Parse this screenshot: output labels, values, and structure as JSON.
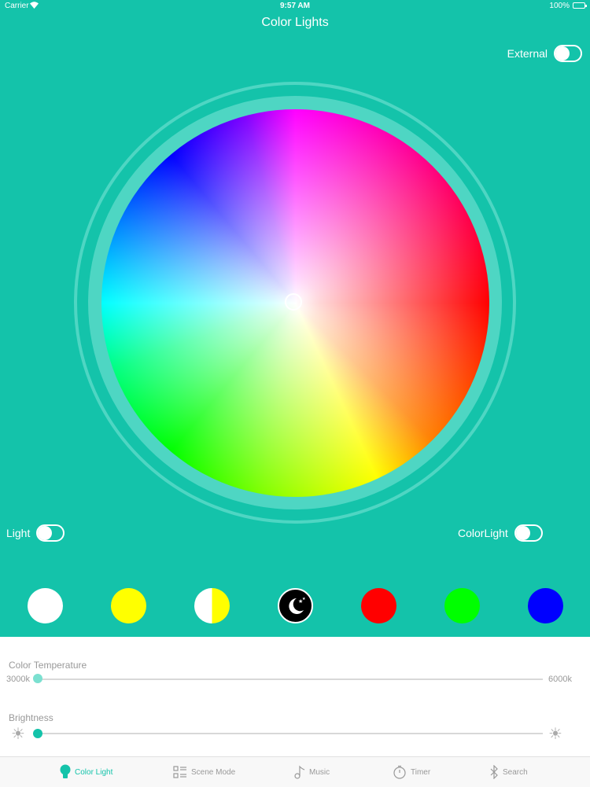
{
  "status": {
    "carrier": "Carrier",
    "time": "9:57 AM",
    "battery": "100%"
  },
  "title": "Color Lights",
  "toggles": {
    "external": {
      "label": "External",
      "on": false
    },
    "light": {
      "label": "Light",
      "on": false
    },
    "colorlight": {
      "label": "ColorLight",
      "on": false
    }
  },
  "presets": [
    {
      "name": "white",
      "color": "#ffffff"
    },
    {
      "name": "yellow",
      "color": "#ffff00"
    },
    {
      "name": "white-yellow",
      "color": "#ffff00"
    },
    {
      "name": "night",
      "color": "#000000"
    },
    {
      "name": "red",
      "color": "#ff0000"
    },
    {
      "name": "green",
      "color": "#00ff00"
    },
    {
      "name": "blue",
      "color": "#0000ff"
    }
  ],
  "color_temperature": {
    "label": "Color Temperature",
    "min_label": "3000k",
    "max_label": "6000k",
    "value": 0.0
  },
  "brightness": {
    "label": "Brightness",
    "value": 0.0
  },
  "colors": {
    "accent": "#14c3aa",
    "ring": "#4ed6c3",
    "temp_thumb": "#7be0d0"
  },
  "tabs": [
    {
      "label": "Color Light",
      "icon": "bulb-icon",
      "active": true
    },
    {
      "label": "Scene Mode",
      "icon": "scene-grid-icon",
      "active": false
    },
    {
      "label": "Music",
      "icon": "music-note-icon",
      "active": false
    },
    {
      "label": "Timer",
      "icon": "stopwatch-icon",
      "active": false
    },
    {
      "label": "Search",
      "icon": "bluetooth-icon",
      "active": false
    }
  ]
}
